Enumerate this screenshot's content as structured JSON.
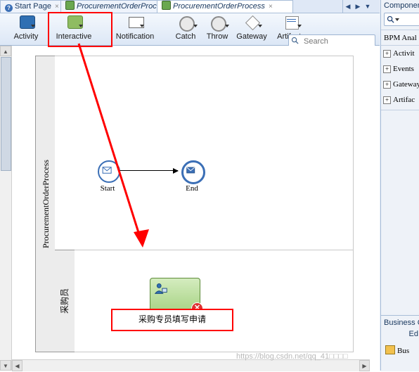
{
  "tabs": [
    {
      "label": "Start Page",
      "icon": "help-icon",
      "active": false,
      "closable": true
    },
    {
      "label": "ProcurementOrderProcess",
      "icon": "page-icon",
      "active": false,
      "closable": true
    },
    {
      "label": "ProcurementOrderProcess",
      "icon": "page-icon",
      "active": true,
      "closable": true
    }
  ],
  "tab_nav": {
    "left": "◀",
    "right": "▶",
    "list": "▼"
  },
  "palette": {
    "tools": [
      {
        "label": "Activity",
        "icon": "activity-icon",
        "has_dropdown": true
      },
      {
        "label": "Interactive",
        "icon": "interactive-icon",
        "has_dropdown": true
      },
      {
        "label": "Notification",
        "icon": "notification-icon",
        "has_dropdown": true
      },
      {
        "label": "Catch",
        "icon": "catch-event-icon",
        "has_dropdown": true
      },
      {
        "label": "Throw",
        "icon": "throw-event-icon",
        "has_dropdown": true
      },
      {
        "label": "Gateway",
        "icon": "gateway-icon",
        "has_dropdown": true
      },
      {
        "label": "Artifacts",
        "icon": "artifacts-icon",
        "has_dropdown": true
      }
    ],
    "search": {
      "placeholder": "Search",
      "value": "",
      "icon": "search-icon"
    }
  },
  "canvas": {
    "pool_label": "ProcurementOrderProcess",
    "lane_label": "采购员",
    "start_event": {
      "label": "Start",
      "icon": "message-start-event-icon"
    },
    "end_event": {
      "label": "End",
      "icon": "message-end-event-icon"
    },
    "task": {
      "label": "",
      "icon": "user-task-icon",
      "error_badge": "✕"
    },
    "callout": {
      "text": "采购专员填写申请"
    },
    "scroll_up": "▲",
    "scroll_down": "▼",
    "scroll_left": "◀",
    "scroll_right": "▶"
  },
  "right_panel": {
    "title": "Componen",
    "search": {
      "placeholder": "",
      "value": "",
      "icon": "search-icon"
    },
    "bpmn_header": "BPM Anal",
    "groups": [
      {
        "label": "Activit",
        "expander": "+"
      },
      {
        "label": "Events",
        "expander": "+"
      },
      {
        "label": "Gateway",
        "expander": "+"
      },
      {
        "label": "Artifac",
        "expander": "+"
      }
    ],
    "bottom": {
      "title": "Business C",
      "edit_label": "Ed",
      "item": "Bus",
      "item_icon": "folder-icon"
    }
  },
  "annotations": {
    "highlight_color": "#ff0000",
    "arrow": "red-arrow-annotation"
  },
  "watermark": "https://blog.csdn.net/qq_41□□□□"
}
